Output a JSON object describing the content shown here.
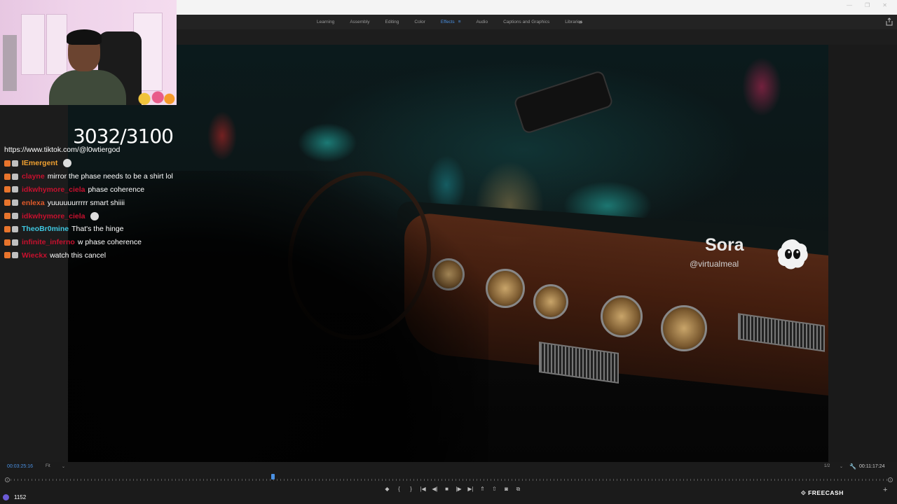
{
  "menu": {
    "items": [
      "Learning",
      "Assembly",
      "Editing",
      "Color",
      "Effects",
      "Audio",
      "Captions and Graphics",
      "Libraries"
    ],
    "active_item": "Effects",
    "more_icon": "double-chevron-right-icon"
  },
  "overlay": {
    "counter": "3032/3100",
    "chat_link": "https://www.tiktok.com/@l0wtiergod"
  },
  "chat": [
    {
      "user": "IEmergent",
      "message": "",
      "color": "#f0a030",
      "emote": true
    },
    {
      "user": "clayne",
      "message": "mirror the phase needs to be a shirt lol",
      "color": "#c8102e"
    },
    {
      "user": "idkwhymore_ciela",
      "message": "phase coherence",
      "color": "#c8102e"
    },
    {
      "user": "enlexa",
      "message": "yuuuuuurrrrr smart shiiii",
      "color": "#e05a2a"
    },
    {
      "user": "idkwhymore_ciela",
      "message": "",
      "color": "#c8102e",
      "emote": true
    },
    {
      "user": "TheoBr0mine",
      "message": "That's the hinge",
      "color": "#3fc7e0"
    },
    {
      "user": "infinite_inferno",
      "message": "w phase coherence",
      "color": "#c8102e"
    },
    {
      "user": "Wieckx",
      "message": "watch this cancel",
      "color": "#c8102e"
    }
  ],
  "video": {
    "watermark_title": "Sora",
    "watermark_handle": "@virtualmeal"
  },
  "controls": {
    "timecode_current": "00:03:25:16",
    "fit_label": "Fit",
    "resolution_label": "1/2",
    "timecode_total": "00:11:17:24",
    "playhead_fraction": 0.3
  },
  "sponsor": "FREECASH",
  "viewer_count": "1152",
  "colors": {
    "accent": "#4a90e2",
    "panel": "#1a1a1a"
  }
}
